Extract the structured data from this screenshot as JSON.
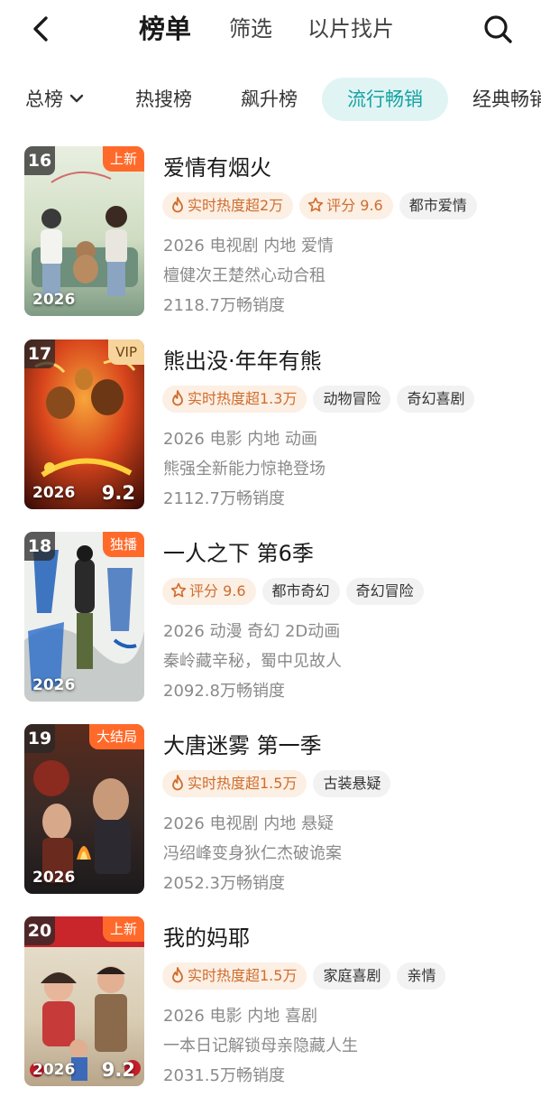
{
  "header": {
    "tabs": [
      "榜单",
      "筛选",
      "以片找片"
    ]
  },
  "categories": [
    {
      "label": "总榜",
      "active": false
    },
    {
      "label": "热搜榜",
      "active": false
    },
    {
      "label": "飙升榜",
      "active": false
    },
    {
      "label": "流行畅销",
      "active": true
    },
    {
      "label": "经典畅销",
      "active": false
    }
  ],
  "colors": {
    "accent": "#17a2a2",
    "accent_bg": "#e1f4f4",
    "hot_text": "#cf6d2d",
    "hot_bg": "#fcefe4",
    "badge_orange": "#ff6a2b",
    "badge_vip": "#f6d49b"
  },
  "icons": {
    "back": "chevron-left-icon",
    "search": "magnifier-icon",
    "hot": "flame-icon",
    "score": "star-icon",
    "dropdown": "chevron-down-icon"
  },
  "items": [
    {
      "rank": "16",
      "badge": "上新",
      "year": "2026",
      "poster_score": "",
      "title": "爱情有烟火",
      "hot": "实时热度超2万",
      "score": "评分 9.6",
      "tags": [
        "都市爱情"
      ],
      "info": "2026 电视剧 内地 爱情",
      "desc": "檀健次王楚然心动合租",
      "sales": "2118.7万畅销度"
    },
    {
      "rank": "17",
      "badge": "VIP",
      "year": "2026",
      "poster_score": "9.2",
      "title": "熊出没·年年有熊",
      "hot": "实时热度超1.3万",
      "score": "",
      "tags": [
        "动物冒险",
        "奇幻喜剧"
      ],
      "info": "2026 电影 内地 动画",
      "desc": "熊强全新能力惊艳登场",
      "sales": "2112.7万畅销度"
    },
    {
      "rank": "18",
      "badge": "独播",
      "year": "2026",
      "poster_score": "",
      "title": "一人之下 第6季",
      "hot": "",
      "score": "评分 9.6",
      "tags": [
        "都市奇幻",
        "奇幻冒险"
      ],
      "info": "2026 动漫 奇幻 2D动画",
      "desc": "秦岭藏辛秘，蜀中见故人",
      "sales": "2092.8万畅销度"
    },
    {
      "rank": "19",
      "badge": "大结局",
      "year": "2026",
      "poster_score": "",
      "title": "大唐迷雾 第一季",
      "hot": "实时热度超1.5万",
      "score": "",
      "tags": [
        "古装悬疑"
      ],
      "info": "2026 电视剧 内地 悬疑",
      "desc": "冯绍峰变身狄仁杰破诡案",
      "sales": "2052.3万畅销度"
    },
    {
      "rank": "20",
      "badge": "上新",
      "year": "2026",
      "poster_score": "9.2",
      "title": "我的妈耶",
      "hot": "实时热度超1.5万",
      "score": "",
      "tags": [
        "家庭喜剧",
        "亲情"
      ],
      "info": "2026 电影 内地 喜剧",
      "desc": "一本日记解锁母亲隐藏人生",
      "sales": "2031.5万畅销度"
    }
  ]
}
